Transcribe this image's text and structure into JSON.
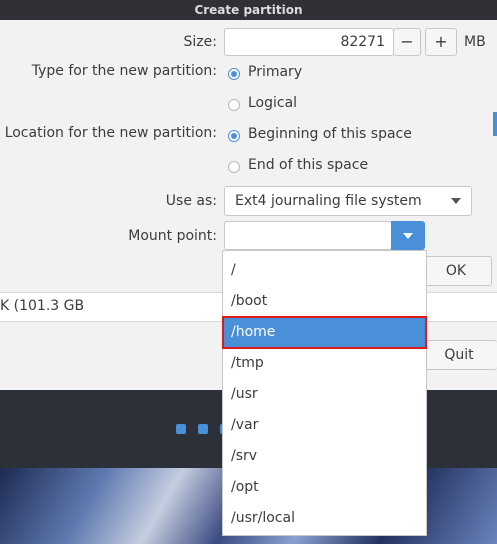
{
  "window": {
    "title": "Create partition"
  },
  "form": {
    "size_label": "Size:",
    "size_value": "82271",
    "minus": "−",
    "plus": "+",
    "unit": "MB",
    "type_label": "Type for the new partition:",
    "type_options": [
      "Primary",
      "Logical"
    ],
    "location_label": "Location for the new partition:",
    "location_options": [
      "Beginning of this space",
      "End of this space"
    ],
    "use_as_label": "Use as:",
    "use_as_value": "Ext4 journaling file system",
    "mount_label": "Mount point:",
    "mount_value": ""
  },
  "background": {
    "ok_label": "OK",
    "quit_label": "Quit",
    "disk_fragment": "K (101.3 GB"
  },
  "mount_options": [
    "/",
    "/boot",
    "/home",
    "/tmp",
    "/usr",
    "/var",
    "/srv",
    "/opt",
    "/usr/local"
  ],
  "selected_option": "/home",
  "colors": {
    "accent": "#4a90d9",
    "highlight_border": "#e01818",
    "title_bar": "#2f3136"
  }
}
